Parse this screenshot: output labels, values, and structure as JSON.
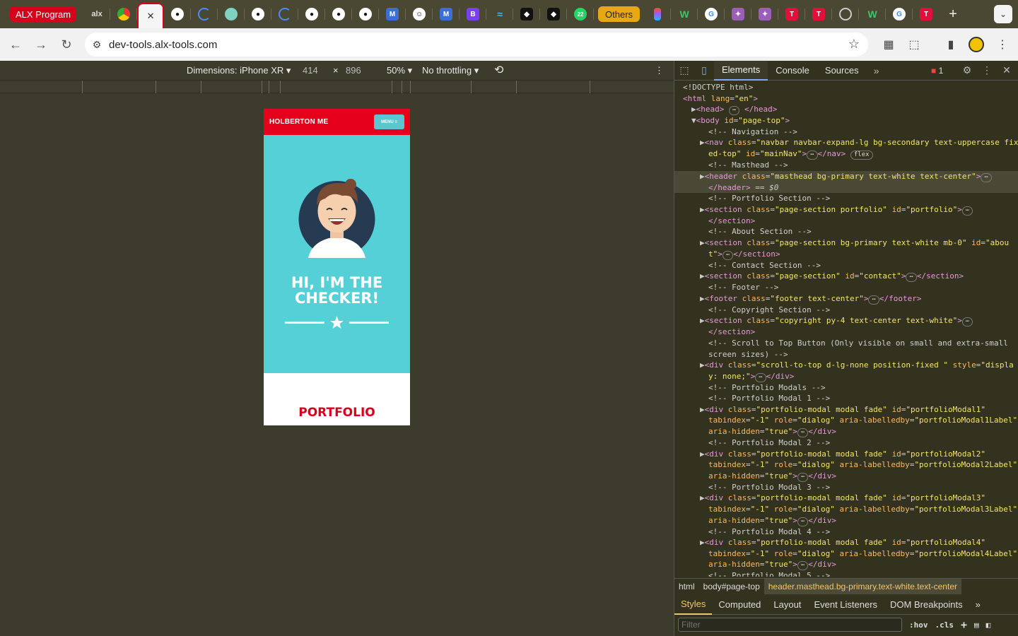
{
  "tabs": {
    "first_label": "ALX Program",
    "others_label": "Others",
    "new_tab_glyph": "+",
    "dropdown_glyph": "⌄",
    "close_glyph": "✕"
  },
  "toolbar": {
    "url": "dev-tools.alx-tools.com"
  },
  "device_toolbar": {
    "dimensions_label": "Dimensions: iPhone XR",
    "width": "414",
    "times": "×",
    "height": "896",
    "zoom": "50%",
    "throttling": "No throttling"
  },
  "site": {
    "brand": "HOLBERTON ME",
    "menu_label": "MENU ≡",
    "hero_line1": "HI, I'M THE",
    "hero_line2": "CHECKER!",
    "section_title": "PORTFOLIO"
  },
  "devtools": {
    "tabs": [
      "Elements",
      "Console",
      "Sources"
    ],
    "more_glyph": "»",
    "error_count": "1",
    "dom": [
      {
        "indent": 0,
        "html": "<span class='cmt'>&lt;!DOCTYPE html&gt;</span>"
      },
      {
        "indent": 0,
        "html": "<span class='tag'>&lt;html</span> <span class='attr'>lang</span>=<span class='val'>\"en\"</span><span class='tag'>&gt;</span>"
      },
      {
        "indent": 1,
        "html": "▶<span class='tag'>&lt;head&gt;</span> <span class='badge'>⋯</span> <span class='tag'>&lt;/head&gt;</span>"
      },
      {
        "indent": 1,
        "html": "▼<span class='tag'>&lt;body</span> <span class='attr'>id</span>=<span class='val'>\"page-top\"</span><span class='tag'>&gt;</span>"
      },
      {
        "indent": 3,
        "html": "<span class='cmt'>&lt;!-- Navigation --&gt;</span>"
      },
      {
        "indent": 2,
        "html": "▶<span class='tag'>&lt;nav</span> <span class='attr'>class</span>=<span class='val'>\"navbar navbar-expand-lg bg-secondary text-uppercase fix</span>"
      },
      {
        "indent": 3,
        "html": "<span class='val'>ed-top\"</span> <span class='attr'>id</span>=<span class='val'>\"mainNav\"</span><span class='tag'>&gt;</span><span class='badge'>⋯</span><span class='tag'>&lt;/nav&gt;</span> <span class='badge'>flex</span>"
      },
      {
        "indent": 3,
        "html": "<span class='cmt'>&lt;!-- Masthead --&gt;</span>"
      },
      {
        "indent": 2,
        "sel": true,
        "html": "▶<span class='tag'>&lt;header</span> <span class='attr'>class</span>=<span class='val'>\"masthead bg-primary text-white text-center\"</span><span class='tag'>&gt;</span><span class='badge'>⋯</span>"
      },
      {
        "indent": 3,
        "sel": true,
        "html": "<span class='tag'>&lt;/header&gt;</span> == <i>$0</i>"
      },
      {
        "indent": 3,
        "html": "<span class='cmt'>&lt;!-- Portfolio Section --&gt;</span>"
      },
      {
        "indent": 2,
        "html": "▶<span class='tag'>&lt;section</span> <span class='attr'>class</span>=<span class='val'>\"page-section portfolio\"</span> <span class='attr'>id</span>=<span class='val'>\"portfolio\"</span><span class='tag'>&gt;</span><span class='badge'>⋯</span>"
      },
      {
        "indent": 3,
        "html": "<span class='tag'>&lt;/section&gt;</span>"
      },
      {
        "indent": 3,
        "html": "<span class='cmt'>&lt;!-- About Section --&gt;</span>"
      },
      {
        "indent": 2,
        "html": "▶<span class='tag'>&lt;section</span> <span class='attr'>class</span>=<span class='val'>\"page-section bg-primary text-white mb-0\"</span> <span class='attr'>id</span>=<span class='val'>\"abou</span>"
      },
      {
        "indent": 3,
        "html": "<span class='val'>t\"</span><span class='tag'>&gt;</span><span class='badge'>⋯</span><span class='tag'>&lt;/section&gt;</span>"
      },
      {
        "indent": 3,
        "html": "<span class='cmt'>&lt;!-- Contact Section --&gt;</span>"
      },
      {
        "indent": 2,
        "html": "▶<span class='tag'>&lt;section</span> <span class='attr'>class</span>=<span class='val'>\"page-section\"</span> <span class='attr'>id</span>=<span class='val'>\"contact\"</span><span class='tag'>&gt;</span><span class='badge'>⋯</span><span class='tag'>&lt;/section&gt;</span>"
      },
      {
        "indent": 3,
        "html": "<span class='cmt'>&lt;!-- Footer --&gt;</span>"
      },
      {
        "indent": 2,
        "html": "▶<span class='tag'>&lt;footer</span> <span class='attr'>class</span>=<span class='val'>\"footer text-center\"</span><span class='tag'>&gt;</span><span class='badge'>⋯</span><span class='tag'>&lt;/footer&gt;</span>"
      },
      {
        "indent": 3,
        "html": "<span class='cmt'>&lt;!-- Copyright Section --&gt;</span>"
      },
      {
        "indent": 2,
        "html": "▶<span class='tag'>&lt;section</span> <span class='attr'>class</span>=<span class='val'>\"copyright py-4 text-center text-white\"</span><span class='tag'>&gt;</span><span class='badge'>⋯</span>"
      },
      {
        "indent": 3,
        "html": "<span class='tag'>&lt;/section&gt;</span>"
      },
      {
        "indent": 3,
        "html": "<span class='cmt'>&lt;!-- Scroll to Top Button (Only visible on small and extra-small</span>"
      },
      {
        "indent": 3,
        "html": "<span class='cmt'>screen sizes) --&gt;</span>"
      },
      {
        "indent": 2,
        "html": "▶<span class='tag'>&lt;div</span> <span class='attr'>class</span>=<span class='val'>\"scroll-to-top d-lg-none position-fixed \"</span> <span class='attr'>style</span>=<span class='val'>\"displa</span>"
      },
      {
        "indent": 3,
        "html": "<span class='val'>y: none;\"</span><span class='tag'>&gt;</span><span class='badge'>⋯</span><span class='tag'>&lt;/div&gt;</span>"
      },
      {
        "indent": 3,
        "html": "<span class='cmt'>&lt;!-- Portfolio Modals --&gt;</span>"
      },
      {
        "indent": 3,
        "html": "<span class='cmt'>&lt;!-- Portfolio Modal 1 --&gt;</span>"
      },
      {
        "indent": 2,
        "html": "▶<span class='tag'>&lt;div</span> <span class='attr'>class</span>=<span class='val'>\"portfolio-modal modal fade\"</span> <span class='attr'>id</span>=<span class='val'>\"portfolioModal1\"</span>"
      },
      {
        "indent": 3,
        "html": "<span class='attr'>tabindex</span>=<span class='val'>\"-1\"</span> <span class='attr'>role</span>=<span class='val'>\"dialog\"</span> <span class='attr'>aria-labelledby</span>=<span class='val'>\"portfolioModal1Label\"</span>"
      },
      {
        "indent": 3,
        "html": "<span class='attr'>aria-hidden</span>=<span class='val'>\"true\"</span><span class='tag'>&gt;</span><span class='badge'>⋯</span><span class='tag'>&lt;/div&gt;</span>"
      },
      {
        "indent": 3,
        "html": "<span class='cmt'>&lt;!-- Portfolio Modal 2 --&gt;</span>"
      },
      {
        "indent": 2,
        "html": "▶<span class='tag'>&lt;div</span> <span class='attr'>class</span>=<span class='val'>\"portfolio-modal modal fade\"</span> <span class='attr'>id</span>=<span class='val'>\"portfolioModal2\"</span>"
      },
      {
        "indent": 3,
        "html": "<span class='attr'>tabindex</span>=<span class='val'>\"-1\"</span> <span class='attr'>role</span>=<span class='val'>\"dialog\"</span> <span class='attr'>aria-labelledby</span>=<span class='val'>\"portfolioModal2Label\"</span>"
      },
      {
        "indent": 3,
        "html": "<span class='attr'>aria-hidden</span>=<span class='val'>\"true\"</span><span class='tag'>&gt;</span><span class='badge'>⋯</span><span class='tag'>&lt;/div&gt;</span>"
      },
      {
        "indent": 3,
        "html": "<span class='cmt'>&lt;!-- Portfolio Modal 3 --&gt;</span>"
      },
      {
        "indent": 2,
        "html": "▶<span class='tag'>&lt;div</span> <span class='attr'>class</span>=<span class='val'>\"portfolio-modal modal fade\"</span> <span class='attr'>id</span>=<span class='val'>\"portfolioModal3\"</span>"
      },
      {
        "indent": 3,
        "html": "<span class='attr'>tabindex</span>=<span class='val'>\"-1\"</span> <span class='attr'>role</span>=<span class='val'>\"dialog\"</span> <span class='attr'>aria-labelledby</span>=<span class='val'>\"portfolioModal3Label\"</span>"
      },
      {
        "indent": 3,
        "html": "<span class='attr'>aria-hidden</span>=<span class='val'>\"true\"</span><span class='tag'>&gt;</span><span class='badge'>⋯</span><span class='tag'>&lt;/div&gt;</span>"
      },
      {
        "indent": 3,
        "html": "<span class='cmt'>&lt;!-- Portfolio Modal 4 --&gt;</span>"
      },
      {
        "indent": 2,
        "html": "▶<span class='tag'>&lt;div</span> <span class='attr'>class</span>=<span class='val'>\"portfolio-modal modal fade\"</span> <span class='attr'>id</span>=<span class='val'>\"portfolioModal4\"</span>"
      },
      {
        "indent": 3,
        "html": "<span class='attr'>tabindex</span>=<span class='val'>\"-1\"</span> <span class='attr'>role</span>=<span class='val'>\"dialog\"</span> <span class='attr'>aria-labelledby</span>=<span class='val'>\"portfolioModal4Label\"</span>"
      },
      {
        "indent": 3,
        "html": "<span class='attr'>aria-hidden</span>=<span class='val'>\"true\"</span><span class='tag'>&gt;</span><span class='badge'>⋯</span><span class='tag'>&lt;/div&gt;</span>"
      },
      {
        "indent": 3,
        "html": "<span class='cmt'>&lt;!-- Portfolio Modal 5 --&gt;</span>"
      }
    ],
    "breadcrumbs": [
      "html",
      "body#page-top",
      "header.masthead.bg-primary.text-white.text-center"
    ],
    "sub_tabs": [
      "Styles",
      "Computed",
      "Layout",
      "Event Listeners",
      "DOM Breakpoints"
    ],
    "filter_placeholder": "Filter",
    "hov_label": ":hov",
    "cls_label": ".cls"
  },
  "colors": {
    "alx_red": "#d6001c",
    "site_teal": "#54d0d6",
    "others_amber": "#e8a813"
  }
}
